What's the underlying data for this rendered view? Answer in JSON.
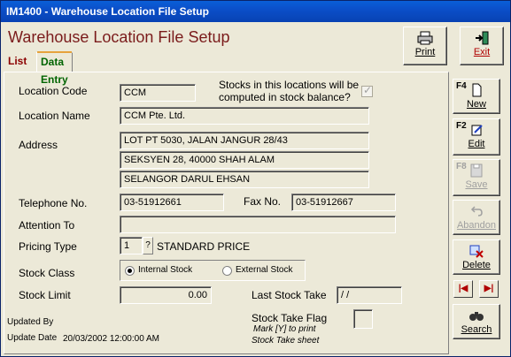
{
  "window": {
    "title": "IM1400 - Warehouse Location File Setup"
  },
  "form": {
    "title": "Warehouse Location File Setup"
  },
  "tabs": {
    "list": "List",
    "data_entry": "Data Entry"
  },
  "toolbar": {
    "print": "Print",
    "exit": "Exit"
  },
  "fields": {
    "location_code_label": "Location Code",
    "location_code": "CCM",
    "stock_balance_note": "Stocks in this locations will be computed in stock balance?",
    "location_name_label": "Location Name",
    "location_name": "CCM Pte. Ltd.",
    "address_label": "Address",
    "address1": "LOT PT 5030, JALAN JANGUR 28/43",
    "address2": "SEKSYEN 28, 40000 SHAH ALAM",
    "address3": "SELANGOR DARUL EHSAN",
    "telephone_label": "Telephone No.",
    "telephone": "03-51912661",
    "fax_label": "Fax No.",
    "fax": "03-51912667",
    "attention_label": "Attention To",
    "attention": "",
    "pricing_type_label": "Pricing Type",
    "pricing_type_code": "1",
    "pricing_type_lookup": "?",
    "pricing_type_name": "STANDARD PRICE",
    "stock_class_label": "Stock Class",
    "stock_class_internal": "Internal Stock",
    "stock_class_external": "External Stock",
    "stock_limit_label": "Stock Limit",
    "stock_limit": "0.00",
    "last_stock_take_label": "Last Stock Take",
    "last_stock_take": " / /",
    "updated_by_label": "Updated By",
    "updated_by": "",
    "update_date_label": "Update Date",
    "update_date": "20/03/2002 12:00:00 AM",
    "stock_take_flag_label": "Stock Take Flag",
    "stock_take_flag_hint1": "Mark [Y] to print",
    "stock_take_flag_hint2": "Stock Take sheet",
    "stock_take_flag": ""
  },
  "side_buttons": {
    "new_key": "F4",
    "new": "New",
    "edit_key": "F2",
    "edit": "Edit",
    "save_key": "F8",
    "save": "Save",
    "abandon": "Abandon",
    "delete": "Delete",
    "search": "Search"
  },
  "colors": {
    "title_red": "#7a1b1b",
    "titlebar_blue": "#0a5fd8"
  }
}
